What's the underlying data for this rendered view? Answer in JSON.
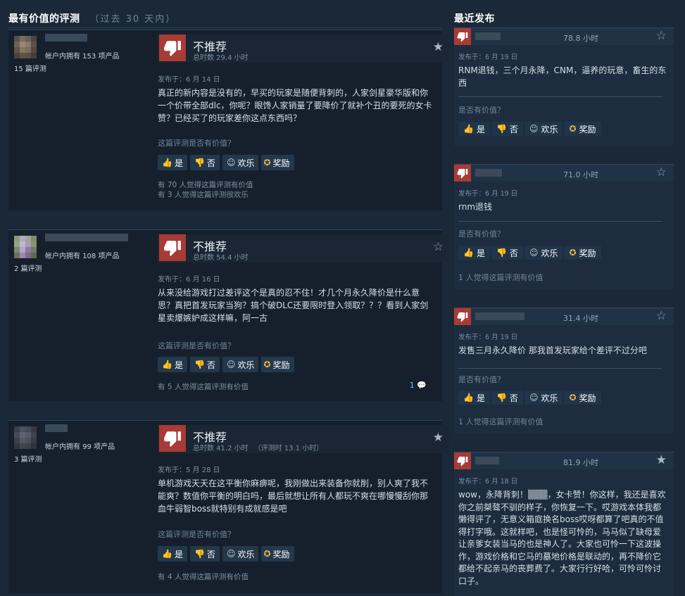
{
  "left_section": {
    "title": "最有价值的评测",
    "subtitle": "（过去 30 天内）"
  },
  "right_section": {
    "title": "最近发布"
  },
  "reviews": [
    {
      "owned": "帐户内拥有 153 项产品",
      "review_count": "15 篇评测",
      "verdict": "不推荐",
      "hours": "总时数 29.4 小时",
      "hours_at_review": "",
      "posted": "发布于：6 月 14 日",
      "text": "真正的新内容是没有的，早买的玩家是随便背刺的，人家剑星豪华版和你一个价带全部dlc，你呢？眼馋人家销量了要降价了就补个丑的要死的女卡赞？已经买了的玩家差你这点东西吗？",
      "helpful_q": "这篇评测是否有价值？",
      "yes": "是",
      "no": "否",
      "funny": "欢乐",
      "award": "奖励",
      "found_helpful": "有 70 人觉得这篇评测有价值",
      "found_funny": "有 3 人觉得这篇评测很欢乐",
      "comments": ""
    },
    {
      "owned": "帐户内拥有 108 项产品",
      "review_count": "2 篇评测",
      "verdict": "不推荐",
      "hours": "总时数 54.4 小时",
      "hours_at_review": "",
      "posted": "发布于：6 月 16 日",
      "text": "从来没给游戏打过差评这个是真的忍不住！才几个月永久降价是什么意思？真把首发玩家当狗？搞个破DLC还要限时登入领取？？？看到人家剑星卖爆嫉妒成这样嘛，阿一古",
      "helpful_q": "这篇评测是否有价值？",
      "yes": "是",
      "no": "否",
      "funny": "欢乐",
      "award": "奖励",
      "found_helpful": "有 5 人觉得这篇评测有价值",
      "found_funny": "",
      "comments": "1"
    },
    {
      "owned": "帐户内拥有 99 项产品",
      "review_count": "3 篇评测",
      "verdict": "不推荐",
      "hours": "总时数 41.2 小时",
      "hours_at_review": "（评测时 13.1 小时）",
      "posted": "发布于：5 月 28 日",
      "text": "单机游戏天天在这平衡你麻痹呢，我刚做出来装备你就削，别人爽了我不能爽？数值你平衡的明白吗，最后就想让所有人都玩不爽在哪慢慢刮你那血牛弱智boss就特别有成就感是吧",
      "helpful_q": "这篇评测是否有价值？",
      "yes": "是",
      "no": "否",
      "funny": "欢乐",
      "award": "奖励",
      "found_helpful": "有 4 人觉得这篇评测有价值",
      "found_funny": "",
      "comments": ""
    }
  ],
  "recent": [
    {
      "hours": "78.8 小时",
      "posted": "发布于：6 月 19 日",
      "text": "RNM退钱，三个月永降，CNM，逼养的玩意，畜生的东西",
      "helpful_q": "是否有价值？",
      "yes": "是",
      "no": "否",
      "funny": "欢乐",
      "award": "奖励",
      "found": ""
    },
    {
      "hours": "71.0 小时",
      "posted": "发布于：6 月 19 日",
      "text": "rnm退钱",
      "helpful_q": "是否有价值？",
      "yes": "是",
      "no": "否",
      "funny": "欢乐",
      "award": "奖励",
      "found": "1 人觉得这篇评测有价值"
    },
    {
      "hours": "31.4 小时",
      "posted": "发布于：6 月 19 日",
      "text": "发售三月永久降价 那我首发玩家给个差评不过分吧",
      "helpful_q": "是否有价值？",
      "yes": "是",
      "no": "否",
      "funny": "欢乐",
      "award": "奖励",
      "found": "1 人觉得这篇评测有价值"
    },
    {
      "hours": "81.9 小时",
      "posted": "发布于：6 月 18 日",
      "text": "wow，永降背刺！▒▒▒，女卡赞！你这样，我还是喜欢你之前桀骜不驯的样子，你恢复一下。哎游戏本体我都懒得评了，无意义箱庭换名boss哎呀都算了吧真的不值得打字哦。这就样吧，也是怪可怜的，马马似了缺母爱让亲爹女装当马的也是神人了。大家也可怜一下这波操作，游戏价格和它马的墓地价格是联动的，再不降价它都给不起亲马的丧葬费了。大家行行好哈，可怜可怜讨口子。",
      "helpful_q": "",
      "yes": "",
      "no": "",
      "funny": "",
      "award": "",
      "found": ""
    }
  ],
  "colors": {
    "background": "#1b2838",
    "thumbs_down": "#a83b35",
    "link_blue": "#67c1f5",
    "award_gold": "#e6b84d"
  },
  "icons": {
    "verdict": "thumbs-down-icon",
    "bookmark": "star-icon",
    "yes": "thumbs-up-icon",
    "no": "thumbs-down-icon",
    "funny": "smiley-icon",
    "award": "award-icon",
    "comment": "speech-bubble-icon"
  }
}
